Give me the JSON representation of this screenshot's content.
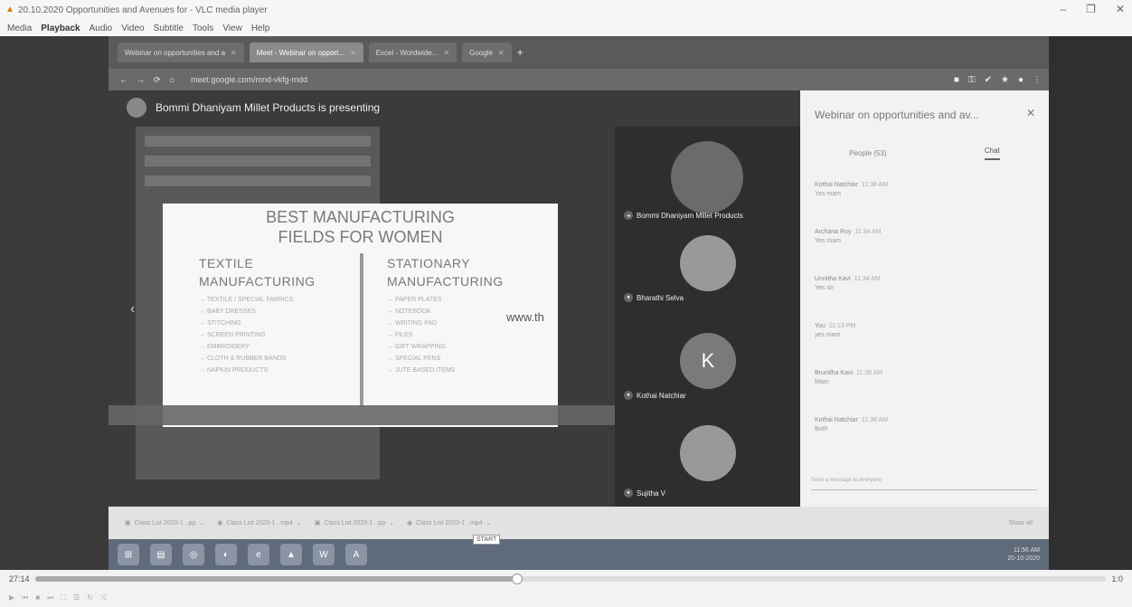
{
  "vlc": {
    "title": "20.10.2020 Opportunities and Avenues for - VLC media player",
    "menu": [
      "Media",
      "Playback",
      "Audio",
      "Video",
      "Subtitle",
      "Tools",
      "View",
      "Help"
    ],
    "current_time": "27:14",
    "end_time": "1:0",
    "progress": 0.45
  },
  "chrome": {
    "tabs": [
      {
        "label": "Webinar on opportunities and a"
      },
      {
        "label": "Meet - Webinar on opport..."
      },
      {
        "label": "Excel - Wordwide..."
      },
      {
        "label": "Google"
      }
    ],
    "url": "meet.google.com/mnd-vkfg-mdd"
  },
  "meet": {
    "presenting": "Bommi Dhaniyam Millet Products is presenting",
    "participants": [
      {
        "name": "Bommi Dhaniyam Millet Products",
        "initial": ""
      },
      {
        "name": "Bharathi Selva",
        "initial": ""
      },
      {
        "name": "Kothai Natchiar",
        "initial": "K"
      },
      {
        "name": "Sujitha V",
        "initial": ""
      }
    ]
  },
  "slide": {
    "title_line1": "BEST MANUFACTURING",
    "title_line2": "FIELDS FOR WOMEN",
    "left_head_1": "TEXTILE",
    "left_head_2": "MANUFACTURING",
    "right_head_1": "STATIONARY",
    "right_head_2": "MANUFACTURING",
    "left_items": [
      "TEXTILE / SPECIAL FABRICS",
      "BABY DRESSES",
      "STITCHING",
      "SCREEN PRINTING",
      "EMBROIDERY",
      "CLOTH & RUBBER BANDS",
      "NAPKIN PRODUCTS"
    ],
    "right_items": [
      "PAPER PLATES",
      "NOTEBOOK",
      "WRITING PAD",
      "FILES",
      "GIFT WRAPPING",
      "SPECIAL PENS",
      "JUTE BASED ITEMS"
    ],
    "watermark": "www.th"
  },
  "chat": {
    "title": "Webinar on opportunities and av...",
    "tab_people": "People (53)",
    "tab_chat": "Chat",
    "messages": [
      {
        "who": "Kothai Natchiar",
        "time": "11:38 AM",
        "text": "Yes mam"
      },
      {
        "who": "Archana Roy",
        "time": "11:34 AM",
        "text": "Yes mam"
      },
      {
        "who": "Unnitha Kavi",
        "time": "11:34 AM",
        "text": "Yes sir"
      },
      {
        "who": "You",
        "time": "11:13 PM",
        "text": "yes mam"
      },
      {
        "who": "Brundha Kavi",
        "time": "11:38 AM",
        "text": "Mam"
      },
      {
        "who": "Kothai Natchiar",
        "time": "11:38 AM",
        "text": "Both"
      }
    ],
    "input_placeholder": "Send a message to everyone"
  },
  "downloads": {
    "items": [
      {
        "label": "Class List 2020-1 ..pp"
      },
      {
        "label": "Class List 2020-1 ..mp4"
      },
      {
        "label": "Class List 2020-1 ..pp"
      },
      {
        "label": "Class List 2020-1 ..mp4"
      }
    ],
    "show_all": "Show all"
  },
  "taskbar": {
    "tooltip": "START",
    "tray_time": "11:56 AM",
    "tray_date": "20-10-2020"
  }
}
